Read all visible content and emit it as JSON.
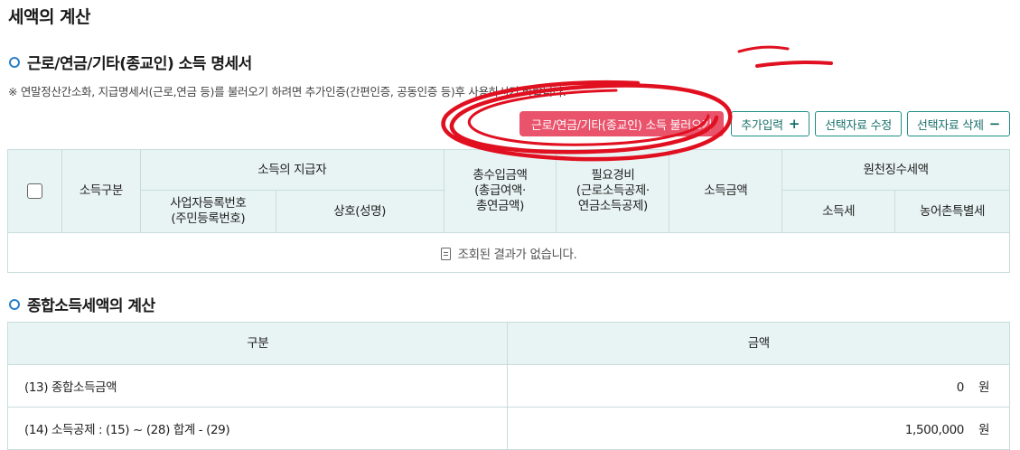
{
  "page": {
    "title": "세액의 계산"
  },
  "income_section": {
    "title": "근로/연금/기타(종교인) 소득 명세서",
    "notice": "※ 연말정산간소화, 지급명세서(근로,연금 등)를 불러오기 하려면 추가인증(간편인증, 공동인증 등)후 사용하시기 바랍니다.",
    "buttons": {
      "import": "근로/연금/기타(종교인) 소득 불러오기",
      "add": "추가입력",
      "edit": "선택자료 수정",
      "delete": "선택자료 삭제"
    },
    "table": {
      "col_income_type": "소득구분",
      "col_payer": "소득의 지급자",
      "col_business_no": "사업자등록번호\n(주민등록번호)",
      "col_trade_name": "상호(성명)",
      "col_gross": "총수입금액\n(총급여액·\n총연금액)",
      "col_expense": "필요경비\n(근로소득공제·\n연금소득공제)",
      "col_income_amount": "소득금액",
      "col_withholding": "원천징수세액",
      "col_income_tax": "소득세",
      "col_rural_tax": "농어촌특별세",
      "empty_message": "조회된 결과가 없습니다."
    }
  },
  "calc_section": {
    "title": "종합소득세액의 계산",
    "headers": {
      "category": "구분",
      "amount": "금액"
    },
    "rows": [
      {
        "label": "(13) 종합소득금액",
        "amount": "0",
        "unit": "원"
      },
      {
        "label": "(14) 소득공제 : (15) ~ (28) 합계 - (29)",
        "amount": "1,500,000",
        "unit": "원"
      }
    ]
  },
  "colors": {
    "accent": "#1e8f88",
    "primary_button": "#e9536b",
    "header_bg": "#e8f4f3",
    "bullet": "#2a7fc9",
    "annotation": "#e01020"
  },
  "icons": [
    "plus-icon",
    "minus-icon",
    "document-icon",
    "bullet-icon"
  ]
}
